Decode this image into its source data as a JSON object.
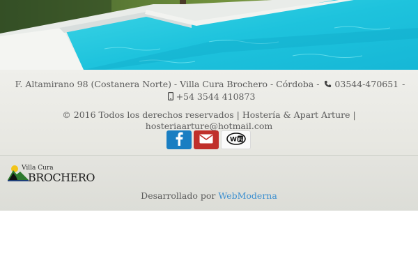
{
  "hero": {
    "image": "swimming-pool-photo"
  },
  "footer": {
    "address": "F. Altamirano 98 (Costanera Norte) - Villa Cura Brochero - Córdoba -",
    "phone_icon": "phone-icon",
    "phone": "03544-470651",
    "separator": "-",
    "mobile_icon": "mobile-icon",
    "mobile": "+54 3544 410873",
    "copyright": "© 2016 Todos los derechos reservados",
    "divider": "|",
    "brand": "Hostería & Apart Arture",
    "email": "hosteriaarture@hotmail.com",
    "social": [
      {
        "name": "facebook",
        "icon": "facebook-icon",
        "color": "#1a7ec2"
      },
      {
        "name": "email",
        "icon": "envelope-icon",
        "color": "#c0302b"
      },
      {
        "name": "wifi",
        "icon": "wifi-icon",
        "color": "#fafafa"
      }
    ]
  },
  "lower": {
    "logo_small": "Villa Cura",
    "logo_big": "BROCHERO",
    "developed_by": "Desarrollado por",
    "developer": "WebModerna"
  }
}
